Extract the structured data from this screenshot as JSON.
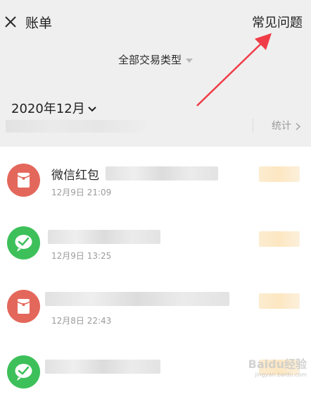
{
  "header": {
    "title": "账单",
    "faq_label": "常见问题"
  },
  "filter": {
    "label": "全部交易类型"
  },
  "month": {
    "label": "2020年12月"
  },
  "stats": {
    "label": "统计"
  },
  "transactions": [
    {
      "name": "微信红包",
      "date": "12月9日 21:09",
      "icon": "red-packet-icon",
      "color": "#e4675b"
    },
    {
      "name": "",
      "date": "12月9日 13:25",
      "icon": "wechat-pay-icon",
      "color": "#3dc05a"
    },
    {
      "name": "",
      "date": "12月8日 22:43",
      "icon": "red-packet-icon",
      "color": "#e4675b"
    },
    {
      "name": "",
      "date": "",
      "icon": "wechat-pay-icon",
      "color": "#3dc05a"
    }
  ],
  "watermark": {
    "text": "Baidu经验",
    "sub": "jingyan.baidu.com"
  }
}
